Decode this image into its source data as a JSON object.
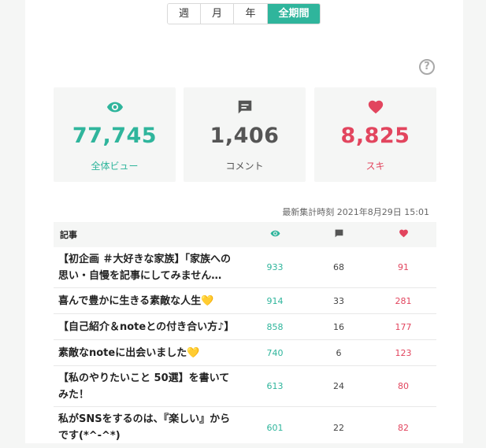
{
  "period_tabs": [
    {
      "label": "週",
      "active": false
    },
    {
      "label": "月",
      "active": false
    },
    {
      "label": "年",
      "active": false
    },
    {
      "label": "全期間",
      "active": true
    }
  ],
  "help_icon": "question-circle-icon",
  "stats": {
    "views": {
      "value": "77,745",
      "label": "全体ビュー",
      "icon": "eye-icon",
      "color": "#2fb59c"
    },
    "comments": {
      "value": "1,406",
      "label": "コメント",
      "icon": "comment-icon",
      "color": "#555555"
    },
    "likes": {
      "value": "8,825",
      "label": "スキ",
      "icon": "heart-icon",
      "color": "#e2455e"
    }
  },
  "timestamp": "最新集計時刻 2021年8月29日 15:01",
  "table": {
    "header_title": "記事",
    "header_icons": [
      "eye-icon",
      "comment-icon",
      "heart-icon"
    ],
    "rows": [
      {
        "title": "【初企画 ＃大好きな家族】「家族への思い・自慢を記事にしてみません…",
        "emoji": "",
        "views": "933",
        "comments": "68",
        "likes": "91"
      },
      {
        "title": "喜んで豊かに生きる素敵な人生",
        "emoji": "💛",
        "views": "914",
        "comments": "33",
        "likes": "281"
      },
      {
        "title": "【自己紹介＆noteとの付き合い方♪】",
        "emoji": "",
        "views": "858",
        "comments": "16",
        "likes": "177"
      },
      {
        "title": "素敵なnoteに出会いました",
        "emoji": "💛",
        "views": "740",
        "comments": "6",
        "likes": "123"
      },
      {
        "title": "【私のやりたいこと 50選】を書いてみた！",
        "emoji": "",
        "views": "613",
        "comments": "24",
        "likes": "80"
      },
      {
        "title": "私がSNSをするのは、『楽しい』からです(*^-^*)",
        "emoji": "",
        "views": "601",
        "comments": "22",
        "likes": "82"
      }
    ]
  }
}
